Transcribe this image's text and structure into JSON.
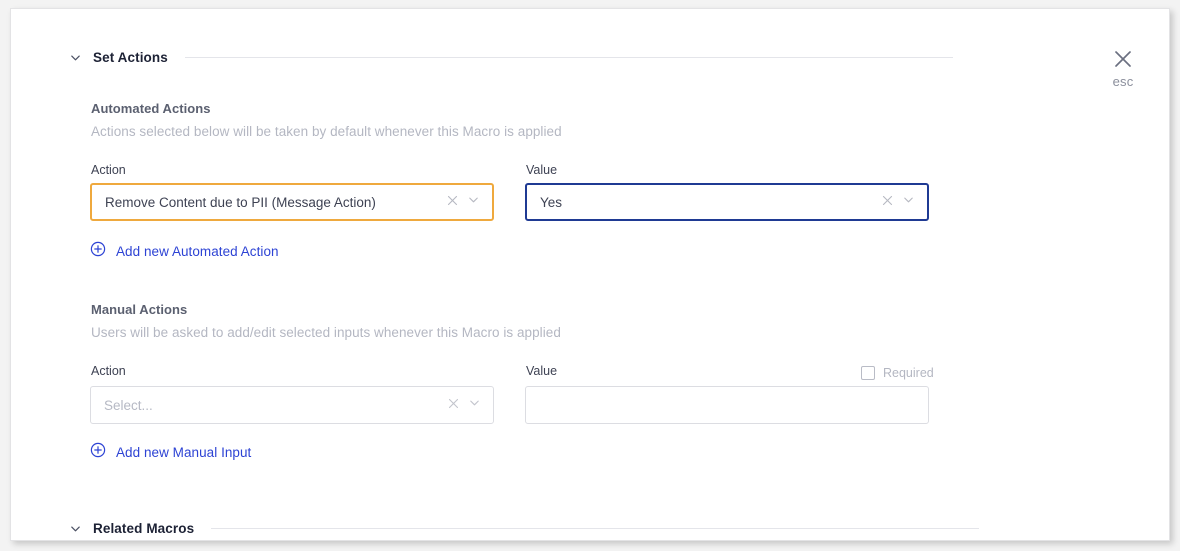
{
  "window": {
    "close": {
      "icon": "close-x-icon",
      "label": "esc"
    }
  },
  "sections": [
    {
      "id": "set-actions",
      "title": "Set Actions",
      "chevron_icon": "chevron-down-icon",
      "expanded": true
    },
    {
      "id": "related-macros",
      "title": "Related Macros",
      "chevron_icon": "chevron-down-icon",
      "expanded": true
    }
  ],
  "automated": {
    "title": "Automated Actions",
    "subtitle": "Actions selected below will be taken by default whenever this Macro is applied",
    "action": {
      "label": "Action",
      "value": "Remove Content due to PII (Message Action)",
      "state": "highlighted",
      "border_color": "#efa93e",
      "clear_icon": "clear-x-icon",
      "dropdown_icon": "chevron-down-icon"
    },
    "value": {
      "label": "Value",
      "value": "Yes",
      "state": "focused",
      "border_color": "#1f3a93",
      "clear_icon": "clear-x-icon",
      "dropdown_icon": "chevron-down-icon"
    },
    "add_link": {
      "label": "Add new Automated Action",
      "icon": "plus-circle-icon",
      "color": "#2d43d4"
    }
  },
  "manual": {
    "title": "Manual Actions",
    "subtitle": "Users will be asked to add/edit selected inputs whenever this Macro is applied",
    "action": {
      "label": "Action",
      "value": "",
      "placeholder": "Select...",
      "clear_icon": "clear-x-icon",
      "dropdown_icon": "chevron-down-icon"
    },
    "value": {
      "label": "Value",
      "value": "",
      "placeholder": ""
    },
    "required": {
      "label": "Required",
      "checked": false
    },
    "add_link": {
      "label": "Add new Manual Input",
      "icon": "plus-circle-icon",
      "color": "#2d43d4"
    }
  }
}
